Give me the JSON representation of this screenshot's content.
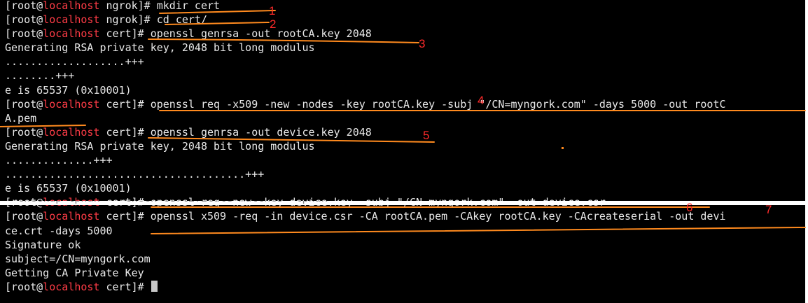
{
  "terminal": {
    "lines": [
      {
        "prompt": {
          "open": "[root@",
          "host": "localhost",
          "dir": " ngrok]# "
        },
        "text": "mkdir cert"
      },
      {
        "prompt": {
          "open": "[root@",
          "host": "localhost",
          "dir": " ngrok]# "
        },
        "text": "cd cert/"
      },
      {
        "prompt": {
          "open": "[root@",
          "host": "localhost",
          "dir": " cert]# "
        },
        "text": "openssl genrsa -out rootCA.key 2048"
      },
      {
        "text": "Generating RSA private key, 2048 bit long modulus"
      },
      {
        "text": "...................+++"
      },
      {
        "text": "........+++"
      },
      {
        "text": "e is 65537 (0x10001)"
      },
      {
        "prompt": {
          "open": "[root@",
          "host": "localhost",
          "dir": " cert]# "
        },
        "text": "openssl req -x509 -new -nodes -key rootCA.key -subj \"/CN=myngork.com\" -days 5000 -out rootC"
      },
      {
        "text": "A.pem"
      },
      {
        "prompt": {
          "open": "[root@",
          "host": "localhost",
          "dir": " cert]# "
        },
        "text": "openssl genrsa -out device.key 2048"
      },
      {
        "text": "Generating RSA private key, 2048 bit long modulus"
      },
      {
        "text": "..............+++"
      },
      {
        "text": "......................................+++"
      },
      {
        "text": "e is 65537 (0x10001)"
      },
      {
        "prompt": {
          "open": "[root@",
          "host": "localhost",
          "dir": " cert]# "
        },
        "text": "openssl req -new -key device.key -subj \"/CN=myngork.com\" -out device.csr"
      },
      {
        "prompt": {
          "open": "[root@",
          "host": "localhost",
          "dir": " cert]# "
        },
        "text": "openssl x509 -req -in device.csr -CA rootCA.pem -CAkey rootCA.key -CAcreateserial -out devi"
      },
      {
        "text": "ce.crt -days 5000"
      },
      {
        "text": "Signature ok"
      },
      {
        "text": "subject=/CN=myngork.com"
      },
      {
        "text": "Getting CA Private Key"
      },
      {
        "prompt": {
          "open": "[root@",
          "host": "localhost",
          "dir": " cert]# "
        },
        "text": "",
        "cursor": true
      }
    ]
  },
  "annotations": {
    "step_numbers": [
      "1",
      "2",
      "3",
      "4",
      "5",
      "6",
      "7"
    ]
  },
  "colors": {
    "terminal_bg": "#000000",
    "terminal_fg": "#e8e8e8",
    "hostname": "#ff3c46",
    "annotation_underline": "#ff8a1e",
    "annotation_number": "#ff2a2a"
  }
}
